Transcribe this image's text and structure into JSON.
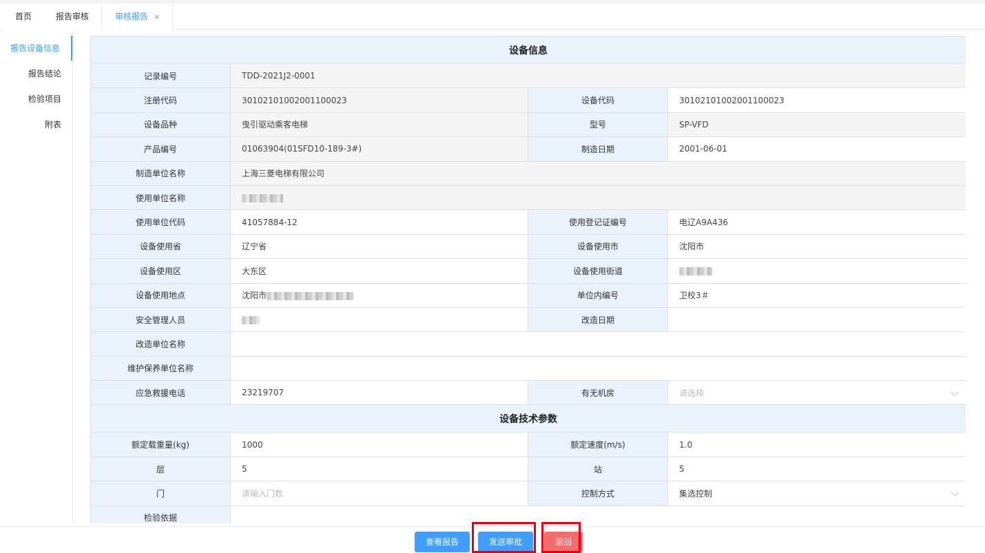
{
  "tabs": [
    {
      "label": "首页"
    },
    {
      "label": "报告审核"
    },
    {
      "label": "审核报告",
      "close": "×"
    }
  ],
  "sidebar": {
    "items": [
      {
        "label": "报告设备信息"
      },
      {
        "label": "报告结论"
      },
      {
        "label": "检验项目"
      },
      {
        "label": "附表"
      }
    ]
  },
  "sections": {
    "info_title": "设备信息",
    "tech_title": "设备技术参数"
  },
  "info": {
    "record_no_label": "记录编号",
    "record_no": "TDD-2021J2-0001",
    "reg_code_label": "注册代码",
    "reg_code": "30102101002001100023",
    "device_code_label": "设备代码",
    "device_code": "30102101002001100023",
    "variety_label": "设备品种",
    "variety": "曳引驱动乘客电梯",
    "model_label": "型号",
    "model": "SP-VFD",
    "product_no_label": "产品编号",
    "product_no": "01063904(01SFD10-189-3#)",
    "mfg_date_label": "制造日期",
    "mfg_date": "2001-06-01",
    "maker_label": "制造单位名称",
    "maker": "上海三菱电梯有限公司",
    "user_name_label": "使用单位名称",
    "user_code_label": "使用单位代码",
    "user_code": "41057884-12",
    "reg_cert_label": "使用登记证编号",
    "reg_cert": "电辽A9A436",
    "province_label": "设备使用省",
    "province": "辽宁省",
    "city_label": "设备使用市",
    "city": "沈阳市",
    "district_label": "设备使用区",
    "district": "大东区",
    "street_label": "设备使用街道",
    "location_label": "设备使用地点",
    "location_prefix": "沈阳市",
    "inner_no_label": "单位内编号",
    "inner_no": "卫校3＃",
    "safety_mgr_label": "安全管理人员",
    "modify_date_label": "改造日期",
    "modify_unit_label": "改造单位名称",
    "maint_unit_label": "维护保养单位名称",
    "rescue_phone_label": "应急救援电话",
    "rescue_phone": "23219707",
    "machine_room_label": "有无机房",
    "machine_room_placeholder": "请选择"
  },
  "tech": {
    "rated_load_label": "额定载重量(kg)",
    "rated_load": "1000",
    "rated_speed_label": "额定速度(m/s)",
    "rated_speed": "1.0",
    "floors_label": "层",
    "floors": "5",
    "stations_label": "站",
    "stations": "5",
    "doors_label": "门",
    "doors_placeholder": "请输入门数",
    "control_label": "控制方式",
    "control": "集选控制",
    "basis_label": "检验依据"
  },
  "footer": {
    "view_report": "查看报告",
    "send_review": "发送审批",
    "return": "退回"
  },
  "colors": {
    "accent": "#409eff",
    "danger": "#f56c6c",
    "highlight": "#e60012",
    "label_bg": "#eaf2fb"
  }
}
